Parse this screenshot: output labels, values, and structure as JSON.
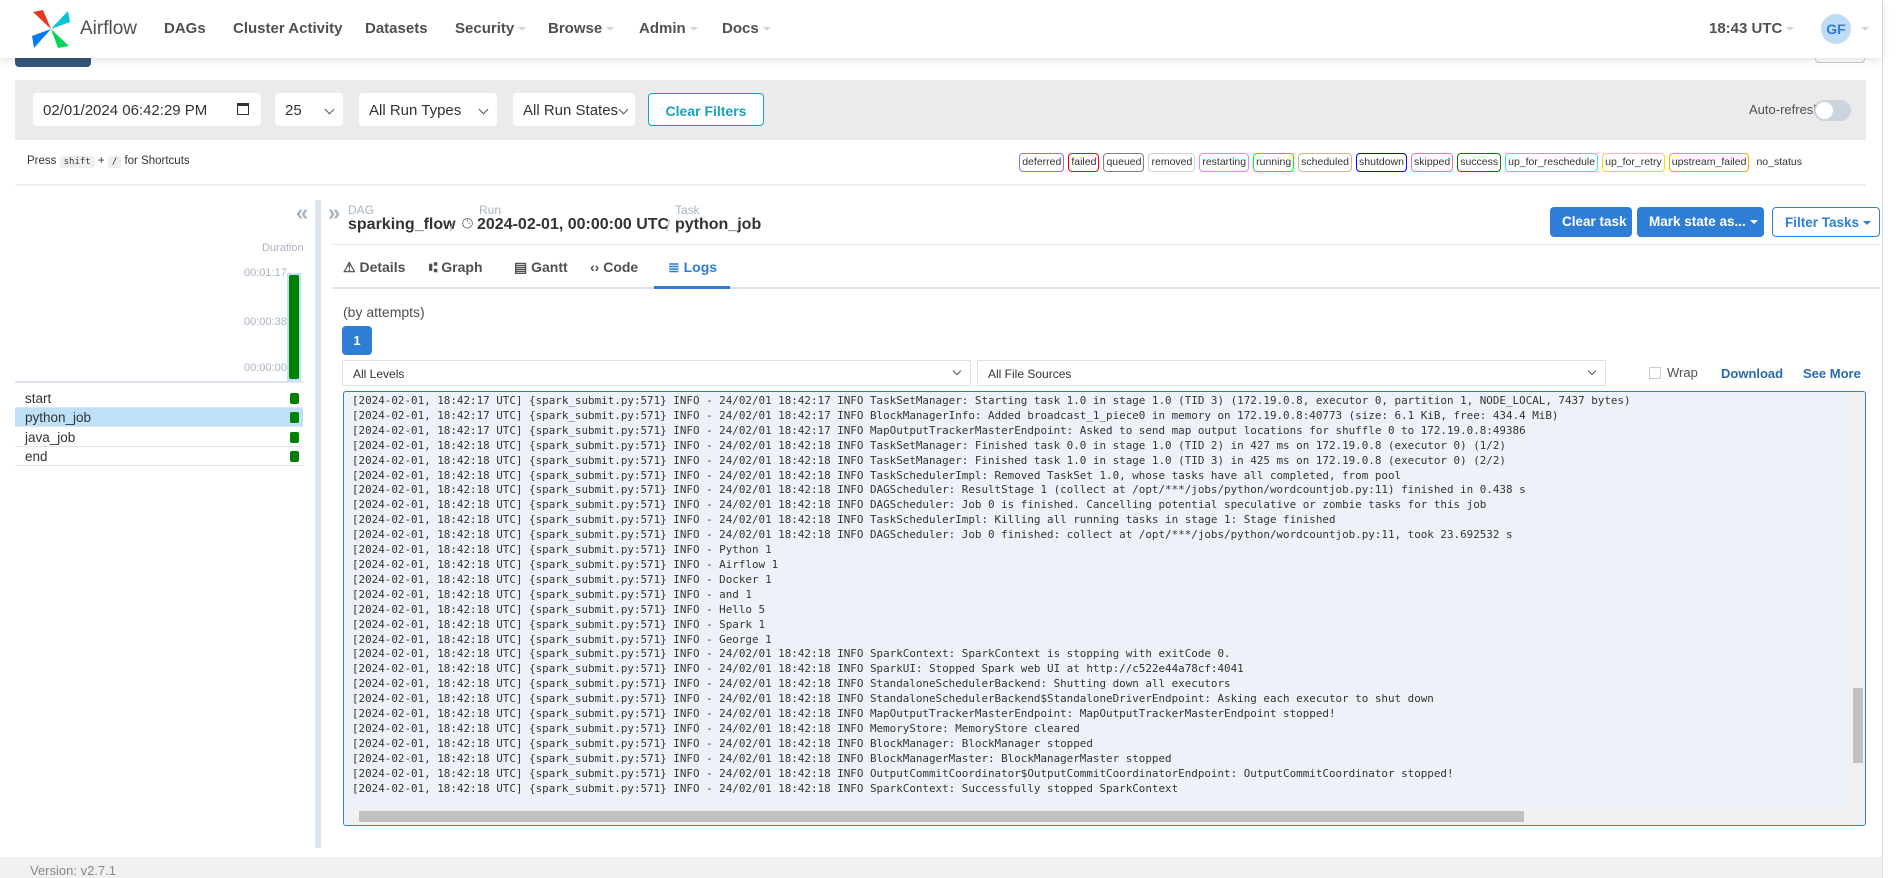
{
  "nav": {
    "brand": "Airflow",
    "items": [
      {
        "label": "DAGs",
        "dd": false
      },
      {
        "label": "Cluster Activity",
        "dd": false
      },
      {
        "label": "Datasets",
        "dd": false
      },
      {
        "label": "Security",
        "dd": true
      },
      {
        "label": "Browse",
        "dd": true
      },
      {
        "label": "Admin",
        "dd": true
      },
      {
        "label": "Docs",
        "dd": true
      }
    ],
    "time": "18:43 UTC",
    "avatar": "GF"
  },
  "filters": {
    "date": "02/01/2024 06:42:29 PM",
    "num_runs": "25",
    "run_types": "All Run Types",
    "run_states": "All Run States",
    "clear": "Clear Filters",
    "auto_refresh": "Auto-refresh",
    "auto_refresh_on": false
  },
  "shortcuts": {
    "press": "Press",
    "key1": "shift",
    "plus": "+",
    "key2": "/",
    "suffix": "for Shortcuts"
  },
  "legend": [
    {
      "label": "deferred",
      "color": "#9370db"
    },
    {
      "label": "failed",
      "color": "#ff0000"
    },
    {
      "label": "queued",
      "color": "#808080"
    },
    {
      "label": "removed",
      "color": "#d3d3d3"
    },
    {
      "label": "restarting",
      "color": "#ee82ee"
    },
    {
      "label": "running",
      "color": "#00ff00"
    },
    {
      "label": "scheduled",
      "color": "#d2b48c"
    },
    {
      "label": "shutdown",
      "color": "#0000ff"
    },
    {
      "label": "skipped",
      "color": "#ff69b4"
    },
    {
      "label": "success",
      "color": "#008000"
    },
    {
      "label": "up_for_reschedule",
      "color": "#40e0d0"
    },
    {
      "label": "up_for_retry",
      "color": "#ffd700"
    },
    {
      "label": "upstream_failed",
      "color": "#ffa500"
    },
    {
      "label": "no_status",
      "color": ""
    }
  ],
  "grid": {
    "duration_label": "Duration",
    "ticks": [
      "00:01:17",
      "00:00:38",
      "00:00:00"
    ],
    "run_state": "success",
    "tasks": [
      {
        "name": "start",
        "state": "success",
        "selected": false
      },
      {
        "name": "python_job",
        "state": "success",
        "selected": true
      },
      {
        "name": "java_job",
        "state": "success",
        "selected": false
      },
      {
        "name": "end",
        "state": "success",
        "selected": false
      }
    ]
  },
  "breadcrumb": {
    "dag_label": "DAG",
    "dag": "sparking_flow",
    "run_label": "Run",
    "run": "2024-02-01, 00:00:00 UTC",
    "task_label": "Task",
    "task": "python_job",
    "sep": "/"
  },
  "actions": {
    "clear_task": "Clear task",
    "mark_state": "Mark state as...",
    "filter_tasks": "Filter Tasks"
  },
  "tabs": [
    {
      "label": "Details",
      "icon": "warning-icon"
    },
    {
      "label": "Graph",
      "icon": "graph-icon"
    },
    {
      "label": "Gantt",
      "icon": "gantt-icon"
    },
    {
      "label": "Code",
      "icon": "code-icon"
    },
    {
      "label": "Logs",
      "icon": "list-icon",
      "active": true
    }
  ],
  "logs": {
    "attempts_label": "(by attempts)",
    "attempt": "1",
    "levels": "All Levels",
    "sources": "All File Sources",
    "wrap": "Wrap",
    "download": "Download",
    "see_more": "See More",
    "lines": [
      "[2024-02-01, 18:42:17 UTC] {spark_submit.py:571} INFO - 24/02/01 18:42:17 INFO TaskSetManager: Starting task 1.0 in stage 1.0 (TID 3) (172.19.0.8, executor 0, partition 1, NODE_LOCAL, 7437 bytes)",
      "[2024-02-01, 18:42:17 UTC] {spark_submit.py:571} INFO - 24/02/01 18:42:17 INFO BlockManagerInfo: Added broadcast_1_piece0 in memory on 172.19.0.8:40773 (size: 6.1 KiB, free: 434.4 MiB)",
      "[2024-02-01, 18:42:17 UTC] {spark_submit.py:571} INFO - 24/02/01 18:42:17 INFO MapOutputTrackerMasterEndpoint: Asked to send map output locations for shuffle 0 to 172.19.0.8:49386",
      "[2024-02-01, 18:42:18 UTC] {spark_submit.py:571} INFO - 24/02/01 18:42:18 INFO TaskSetManager: Finished task 0.0 in stage 1.0 (TID 2) in 427 ms on 172.19.0.8 (executor 0) (1/2)",
      "[2024-02-01, 18:42:18 UTC] {spark_submit.py:571} INFO - 24/02/01 18:42:18 INFO TaskSetManager: Finished task 1.0 in stage 1.0 (TID 3) in 425 ms on 172.19.0.8 (executor 0) (2/2)",
      "[2024-02-01, 18:42:18 UTC] {spark_submit.py:571} INFO - 24/02/01 18:42:18 INFO TaskSchedulerImpl: Removed TaskSet 1.0, whose tasks have all completed, from pool",
      "[2024-02-01, 18:42:18 UTC] {spark_submit.py:571} INFO - 24/02/01 18:42:18 INFO DAGScheduler: ResultStage 1 (collect at /opt/***/jobs/python/wordcountjob.py:11) finished in 0.438 s",
      "[2024-02-01, 18:42:18 UTC] {spark_submit.py:571} INFO - 24/02/01 18:42:18 INFO DAGScheduler: Job 0 is finished. Cancelling potential speculative or zombie tasks for this job",
      "[2024-02-01, 18:42:18 UTC] {spark_submit.py:571} INFO - 24/02/01 18:42:18 INFO TaskSchedulerImpl: Killing all running tasks in stage 1: Stage finished",
      "[2024-02-01, 18:42:18 UTC] {spark_submit.py:571} INFO - 24/02/01 18:42:18 INFO DAGScheduler: Job 0 finished: collect at /opt/***/jobs/python/wordcountjob.py:11, took 23.692532 s",
      "[2024-02-01, 18:42:18 UTC] {spark_submit.py:571} INFO - Python 1",
      "[2024-02-01, 18:42:18 UTC] {spark_submit.py:571} INFO - Airflow 1",
      "[2024-02-01, 18:42:18 UTC] {spark_submit.py:571} INFO - Docker 1",
      "[2024-02-01, 18:42:18 UTC] {spark_submit.py:571} INFO - and 1",
      "[2024-02-01, 18:42:18 UTC] {spark_submit.py:571} INFO - Hello 5",
      "[2024-02-01, 18:42:18 UTC] {spark_submit.py:571} INFO - Spark 1",
      "[2024-02-01, 18:42:18 UTC] {spark_submit.py:571} INFO - George 1",
      "[2024-02-01, 18:42:18 UTC] {spark_submit.py:571} INFO - 24/02/01 18:42:18 INFO SparkContext: SparkContext is stopping with exitCode 0.",
      "[2024-02-01, 18:42:18 UTC] {spark_submit.py:571} INFO - 24/02/01 18:42:18 INFO SparkUI: Stopped Spark web UI at http://c522e44a78cf:4041",
      "[2024-02-01, 18:42:18 UTC] {spark_submit.py:571} INFO - 24/02/01 18:42:18 INFO StandaloneSchedulerBackend: Shutting down all executors",
      "[2024-02-01, 18:42:18 UTC] {spark_submit.py:571} INFO - 24/02/01 18:42:18 INFO StandaloneSchedulerBackend$StandaloneDriverEndpoint: Asking each executor to shut down",
      "[2024-02-01, 18:42:18 UTC] {spark_submit.py:571} INFO - 24/02/01 18:42:18 INFO MapOutputTrackerMasterEndpoint: MapOutputTrackerMasterEndpoint stopped!",
      "[2024-02-01, 18:42:18 UTC] {spark_submit.py:571} INFO - 24/02/01 18:42:18 INFO MemoryStore: MemoryStore cleared",
      "[2024-02-01, 18:42:18 UTC] {spark_submit.py:571} INFO - 24/02/01 18:42:18 INFO BlockManager: BlockManager stopped",
      "[2024-02-01, 18:42:18 UTC] {spark_submit.py:571} INFO - 24/02/01 18:42:18 INFO BlockManagerMaster: BlockManagerMaster stopped",
      "[2024-02-01, 18:42:18 UTC] {spark_submit.py:571} INFO - 24/02/01 18:42:18 INFO OutputCommitCoordinator$OutputCommitCoordinatorEndpoint: OutputCommitCoordinator stopped!",
      "[2024-02-01, 18:42:18 UTC] {spark_submit.py:571} INFO - 24/02/01 18:42:18 INFO SparkContext: Successfully stopped SparkContext"
    ]
  },
  "footer": {
    "version": "Version: v2.7.1"
  },
  "colors": {
    "primary": "#2d7ed4",
    "success": "#008000",
    "selected_row": "#bfe1f7"
  }
}
